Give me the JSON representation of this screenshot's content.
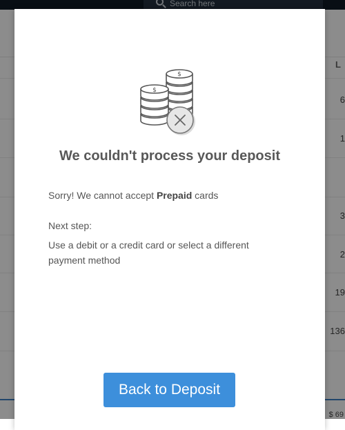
{
  "background": {
    "search_placeholder": "Search here",
    "column_header": "L",
    "cells": [
      "6",
      "1",
      "3",
      "2",
      "19",
      "136"
    ],
    "footer_text": "$ 69"
  },
  "modal": {
    "illustration_icon": "coins-stack-with-x-icon",
    "title": "We couldn't process your deposit",
    "message_prefix": "Sorry! We cannot accept ",
    "message_card_type": "Prepaid",
    "message_suffix": " cards",
    "next_step_label": "Next step:",
    "next_step_text": "Use a debit or a credit card or select a different payment method",
    "button_label": "Back to Deposit"
  },
  "colors": {
    "accent": "#3d8fdb",
    "title_text": "#585858",
    "topbar": "#0f1b26"
  }
}
